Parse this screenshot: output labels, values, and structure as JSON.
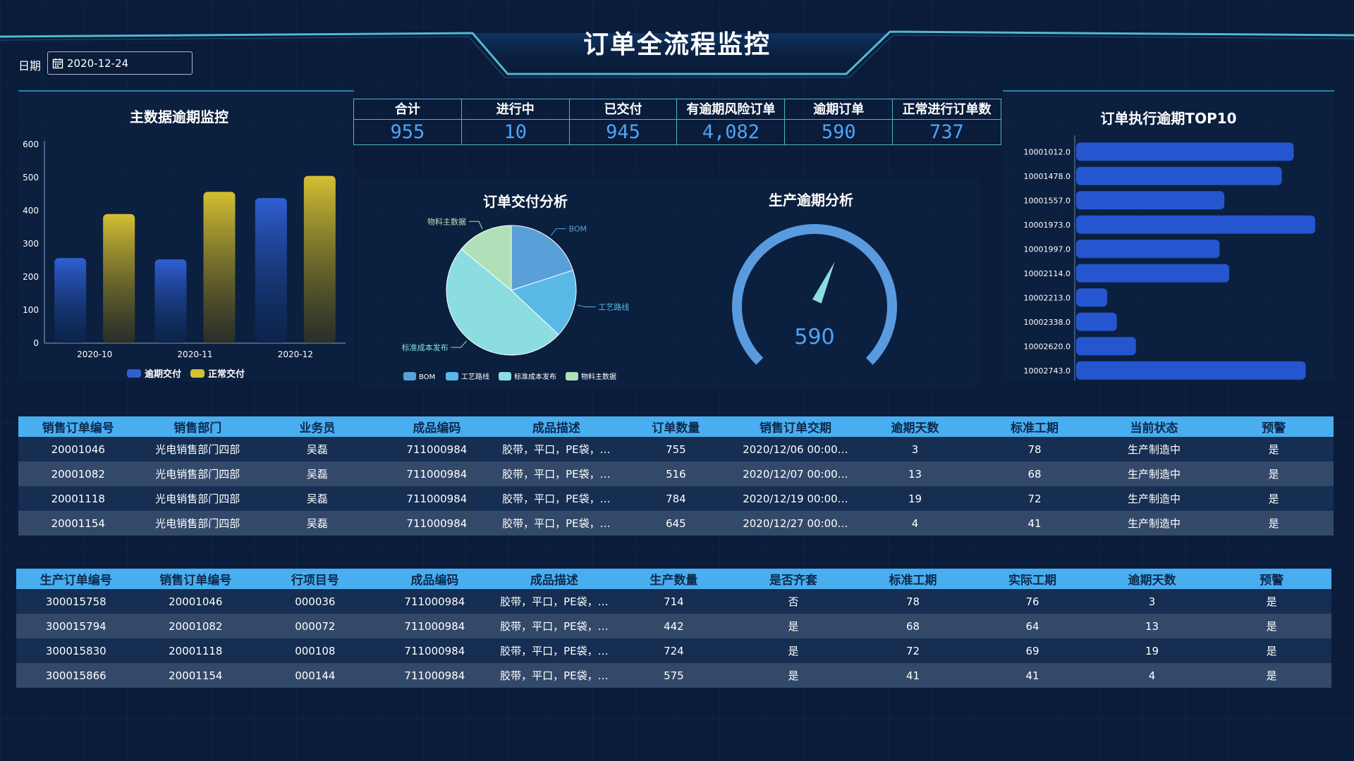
{
  "header": {
    "title": "订单全流程监控",
    "date_label": "日期",
    "date_value": "2020-12-24"
  },
  "colors": {
    "accent_cyan": "#5fd3e8",
    "kpi_value": "#4fa3f7",
    "table_header": "#49aef0",
    "bar_blue": "#2f5fd3",
    "bar_gold": "#d4c033",
    "hbar_blue": "#2555cf",
    "gauge": "#5a9be0"
  },
  "kpis": [
    {
      "label": "合计",
      "value": "955"
    },
    {
      "label": "进行中",
      "value": "10"
    },
    {
      "label": "已交付",
      "value": "945"
    },
    {
      "label": "有逾期风险订单",
      "value": "4,082"
    },
    {
      "label": "逾期订单",
      "value": "590"
    },
    {
      "label": "正常进行订单数",
      "value": "737"
    }
  ],
  "master_chart": {
    "title": "主数据逾期监控",
    "chart_data": {
      "type": "bar",
      "categories": [
        "2020-10",
        "2020-11",
        "2020-12"
      ],
      "series": [
        {
          "name": "逾期交付",
          "values": [
            257,
            253,
            438
          ],
          "color": "#2f5fd3"
        },
        {
          "name": "正常交付",
          "values": [
            390,
            457,
            505
          ],
          "color": "#d4c033"
        }
      ],
      "ylim": [
        0,
        600
      ],
      "yticks": [
        0,
        100,
        200,
        300,
        400,
        500,
        600
      ],
      "legend": "bottom"
    }
  },
  "pie_chart": {
    "title": "订单交付分析",
    "chart_data": {
      "type": "pie",
      "labels": [
        "BOM",
        "工艺路线",
        "标准成本发布",
        "物料主数据"
      ],
      "values": [
        20,
        17,
        49,
        14
      ],
      "colors": [
        "#5aa0d8",
        "#5ab8e6",
        "#8cdde0",
        "#b0e0b8"
      ],
      "legend": "bottom"
    }
  },
  "gauge_chart": {
    "title": "生产逾期分析",
    "value": "590",
    "fraction": 0.59
  },
  "top10_chart": {
    "title": "订单执行逾期TOP10",
    "chart_data": {
      "type": "bar",
      "orientation": "horizontal",
      "categories": [
        "10001012.0",
        "10001478.0",
        "10001557.0",
        "10001973.0",
        "10001997.0",
        "10002114.0",
        "10002213.0",
        "10002338.0",
        "10002620.0",
        "10002743.0"
      ],
      "values": [
        91,
        86,
        62,
        100,
        60,
        64,
        13,
        17,
        25,
        96
      ],
      "xlim": [
        0,
        105
      ],
      "grid": false
    }
  },
  "sales_table": {
    "columns": [
      "销售订单编号",
      "销售部门",
      "业务员",
      "成品编码",
      "成品描述",
      "订单数量",
      "销售订单交期",
      "逾期天数",
      "标准工期",
      "当前状态",
      "预警"
    ],
    "rows": [
      [
        "20001046",
        "光电销售部门四部",
        "吴磊",
        "711000984",
        "胶带，平口，PE袋，…",
        "755",
        "2020/12/06 00:00…",
        "3",
        "78",
        "生产制造中",
        "是"
      ],
      [
        "20001082",
        "光电销售部门四部",
        "吴磊",
        "711000984",
        "胶带，平口，PE袋，…",
        "516",
        "2020/12/07 00:00…",
        "13",
        "68",
        "生产制造中",
        "是"
      ],
      [
        "20001118",
        "光电销售部门四部",
        "吴磊",
        "711000984",
        "胶带，平口，PE袋，…",
        "784",
        "2020/12/19 00:00…",
        "19",
        "72",
        "生产制造中",
        "是"
      ],
      [
        "20001154",
        "光电销售部门四部",
        "吴磊",
        "711000984",
        "胶带，平口，PE袋，…",
        "645",
        "2020/12/27 00:00…",
        "4",
        "41",
        "生产制造中",
        "是"
      ]
    ]
  },
  "production_table": {
    "columns": [
      "生产订单编号",
      "销售订单编号",
      "行项目号",
      "成品编码",
      "成品描述",
      "生产数量",
      "是否齐套",
      "标准工期",
      "实际工期",
      "逾期天数",
      "预警"
    ],
    "rows": [
      [
        "300015758",
        "20001046",
        "000036",
        "711000984",
        "胶带，平口，PE袋，…",
        "714",
        "否",
        "78",
        "76",
        "3",
        "是"
      ],
      [
        "300015794",
        "20001082",
        "000072",
        "711000984",
        "胶带，平口，PE袋，…",
        "442",
        "是",
        "68",
        "64",
        "13",
        "是"
      ],
      [
        "300015830",
        "20001118",
        "000108",
        "711000984",
        "胶带，平口，PE袋，…",
        "724",
        "是",
        "72",
        "69",
        "19",
        "是"
      ],
      [
        "300015866",
        "20001154",
        "000144",
        "711000984",
        "胶带，平口，PE袋，…",
        "575",
        "是",
        "41",
        "41",
        "4",
        "是"
      ]
    ]
  }
}
